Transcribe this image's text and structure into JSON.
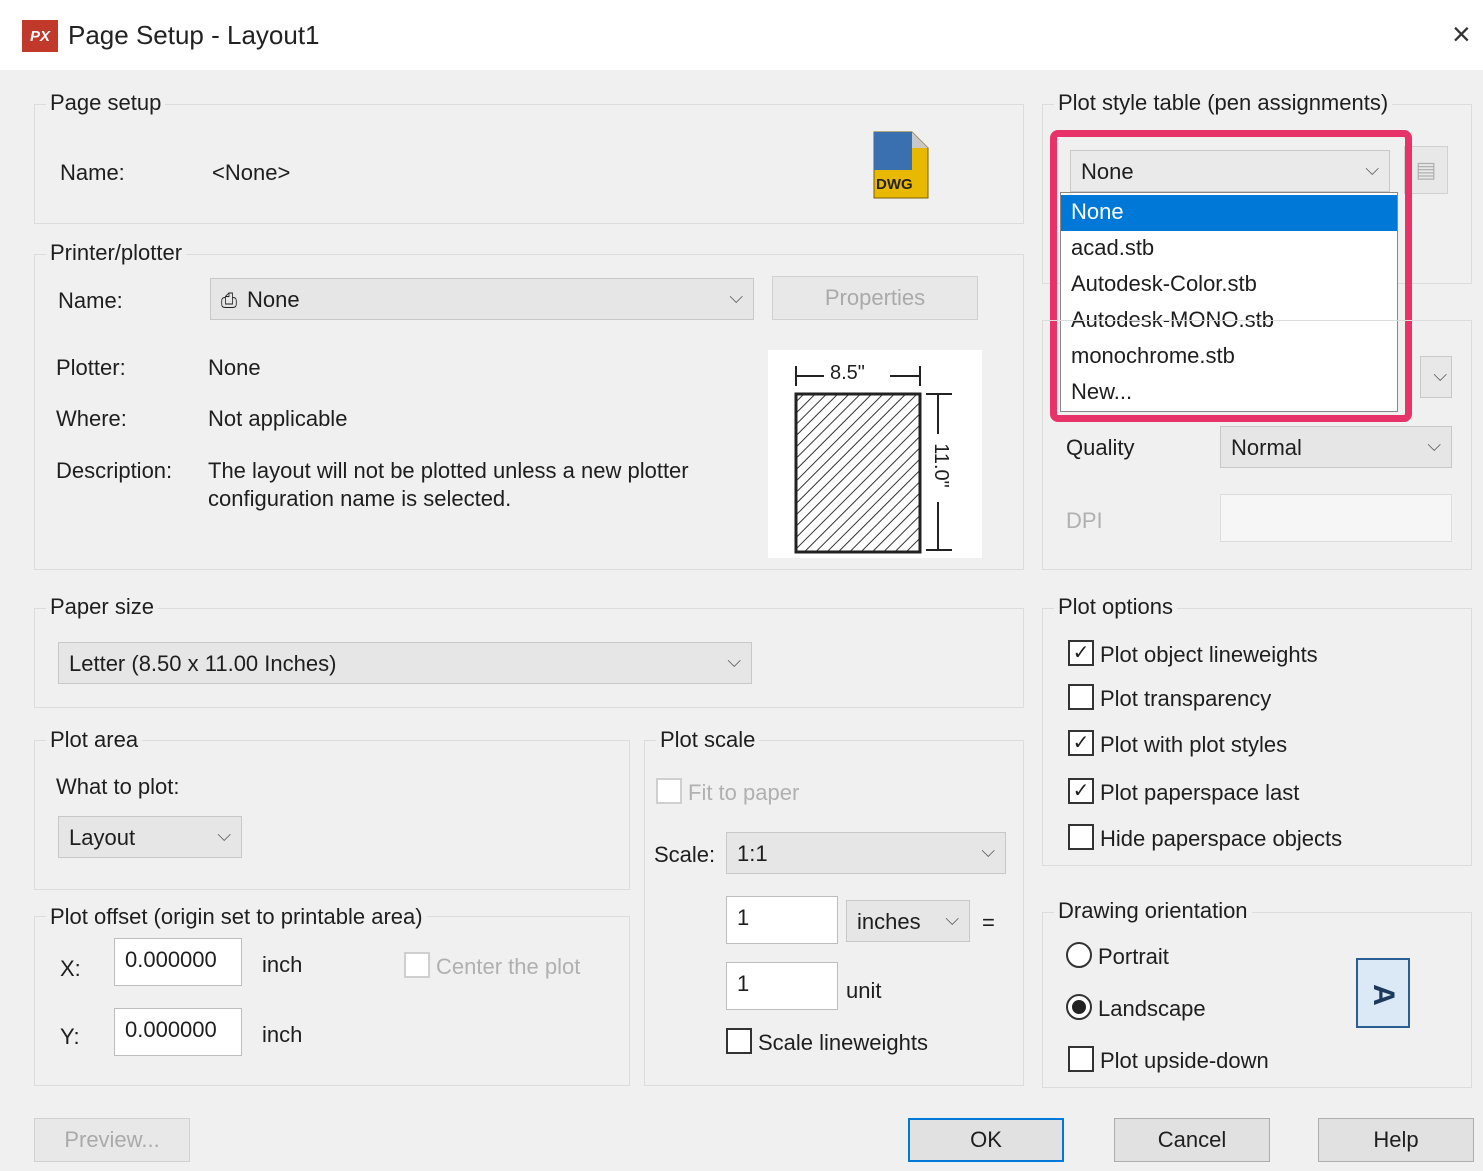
{
  "window": {
    "icon_text": "PX",
    "title": "Page Setup - Layout1",
    "close": "×"
  },
  "page_setup": {
    "title": "Page setup",
    "name_label": "Name:",
    "name_value": "<None>",
    "dwg_badge": "DWG"
  },
  "printer": {
    "title": "Printer/plotter",
    "name_label": "Name:",
    "name_value": "None",
    "properties_label": "Properties",
    "plotter_label": "Plotter:",
    "plotter_value": "None",
    "where_label": "Where:",
    "where_value": "Not applicable",
    "desc_label": "Description:",
    "desc_line1": "The layout will not be plotted unless a new plotter",
    "desc_line2": "configuration name is selected.",
    "preview_width": "8.5\"",
    "preview_height": "11.0\""
  },
  "paper": {
    "title": "Paper size",
    "value": "Letter (8.50 x 11.00 Inches)"
  },
  "plot_area": {
    "title": "Plot area",
    "what_label": "What to plot:",
    "what_value": "Layout"
  },
  "plot_offset": {
    "title": "Plot offset (origin set to printable area)",
    "x_label": "X:",
    "x_value": "0.000000",
    "x_unit": "inch",
    "y_label": "Y:",
    "y_value": "0.000000",
    "y_unit": "inch",
    "center_label": "Center the plot",
    "center_checked": false
  },
  "plot_scale": {
    "title": "Plot scale",
    "fit_label": "Fit to paper",
    "fit_checked": false,
    "scale_label": "Scale:",
    "scale_value": "1:1",
    "value1": "1",
    "unit1": "inches",
    "equals": "=",
    "value2": "1",
    "unit2": "unit",
    "lineweights_label": "Scale lineweights",
    "lineweights_checked": false
  },
  "plot_style": {
    "title": "Plot style table (pen assignments)",
    "value": "None",
    "options": [
      "None",
      "acad.stb",
      "Autodesk-Color.stb",
      "Autodesk-MONO.stb",
      "monochrome.stb",
      "New..."
    ],
    "selected_index": 0
  },
  "shaded": {
    "quality_label": "Quality",
    "quality_value": "Normal",
    "dpi_label": "DPI",
    "dpi_value": ""
  },
  "plot_options": {
    "title": "Plot options",
    "items": [
      {
        "label": "Plot object lineweights",
        "checked": true
      },
      {
        "label": "Plot transparency",
        "checked": false
      },
      {
        "label": "Plot with plot styles",
        "checked": true
      },
      {
        "label": "Plot paperspace last",
        "checked": true
      },
      {
        "label": "Hide paperspace objects",
        "checked": false
      }
    ]
  },
  "orientation": {
    "title": "Drawing orientation",
    "portrait_label": "Portrait",
    "portrait_selected": false,
    "landscape_label": "Landscape",
    "landscape_selected": true,
    "upside_label": "Plot upside-down",
    "upside_checked": false,
    "icon_glyph": "A"
  },
  "buttons": {
    "preview": "Preview...",
    "ok": "OK",
    "cancel": "Cancel",
    "help": "Help"
  },
  "colors": {
    "accent": "#0078d7",
    "highlight": "#e8336a",
    "app_icon": "#c0392b"
  }
}
